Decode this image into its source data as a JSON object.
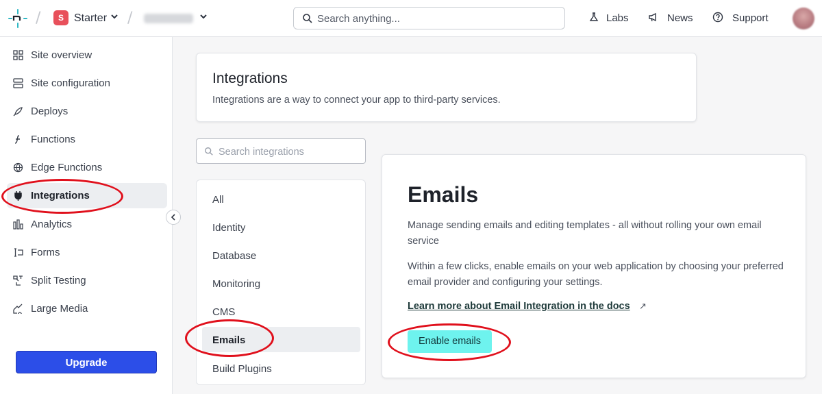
{
  "topbar": {
    "team_badge": "S",
    "team_name": "Starter",
    "search_placeholder": "Search anything...",
    "nav": [
      {
        "label": "Labs",
        "icon": "flask-icon"
      },
      {
        "label": "News",
        "icon": "megaphone-icon"
      },
      {
        "label": "Support",
        "icon": "help-circle-icon"
      }
    ]
  },
  "sidebar": {
    "items": [
      {
        "label": "Site overview",
        "icon": "grid-icon"
      },
      {
        "label": "Site configuration",
        "icon": "server-icon"
      },
      {
        "label": "Deploys",
        "icon": "rocket-icon"
      },
      {
        "label": "Functions",
        "icon": "lambda-icon"
      },
      {
        "label": "Edge Functions",
        "icon": "globe-icon"
      },
      {
        "label": "Integrations",
        "icon": "plug-icon",
        "active": true
      },
      {
        "label": "Analytics",
        "icon": "bar-chart-icon"
      },
      {
        "label": "Forms",
        "icon": "form-icon"
      },
      {
        "label": "Split Testing",
        "icon": "split-icon"
      },
      {
        "label": "Large Media",
        "icon": "media-icon"
      }
    ],
    "upgrade_label": "Upgrade"
  },
  "main": {
    "title": "Integrations",
    "subtitle": "Integrations are a way to connect your app to third-party services.",
    "search_placeholder": "Search integrations",
    "categories": [
      "All",
      "Identity",
      "Database",
      "Monitoring",
      "CMS",
      "Emails",
      "Build Plugins"
    ],
    "active_category": "Emails",
    "detail": {
      "title": "Emails",
      "description1": "Manage sending emails and editing templates - all without rolling your own email service",
      "description2": "Within a few clicks, enable emails on your web application by choosing your preferred email provider and configuring your settings.",
      "doc_link": "Learn more about Email Integration in the docs",
      "doc_link_arrow": "↗",
      "enable_button": "Enable emails"
    }
  },
  "colors": {
    "upgrade": "#2c4ee8",
    "enable": "#6ef3ee",
    "team_badge": "#e8505b",
    "annotation": "#e0101c",
    "logo": "#2fb8c4"
  }
}
